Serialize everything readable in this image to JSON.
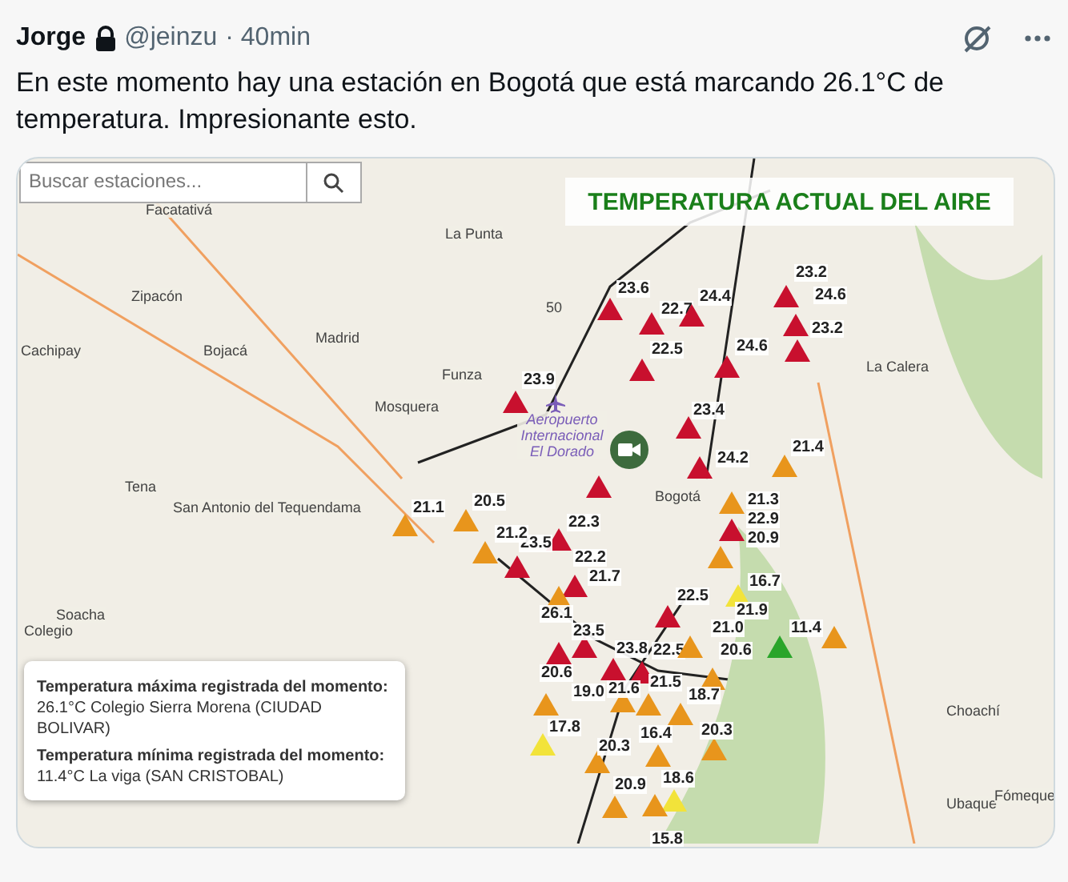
{
  "post": {
    "author": "Jorge",
    "handle": "@jeinzu",
    "time": "· 40min",
    "protected": true,
    "text": "En este momento hay una estación en Bogotá que está marcando 26.1°C de temperatura. Impresionante esto."
  },
  "map": {
    "search": {
      "placeholder": "Buscar estaciones..."
    },
    "title": "TEMPERATURA ACTUAL DEL AIRE",
    "places": [
      "Facatativá",
      "La Punta",
      "Madrid",
      "Zipacón",
      "Bojacá",
      "Cachipay",
      "Funza",
      "Mosquera",
      "Tena",
      "San Antonio del Tequendama",
      "Soacha",
      "Bogotá",
      "La Calera",
      "Choachí",
      "Ubaque",
      "Fómeque",
      "Colegio",
      "Aeropuerto Internacional El Dorado",
      "50"
    ],
    "stations": [
      {
        "reading": "23.6",
        "color": "#c8102e"
      },
      {
        "reading": "22.7",
        "color": "#c8102e"
      },
      {
        "reading": "24.4",
        "color": "#c8102e"
      },
      {
        "reading": "22.5",
        "color": "#c8102e"
      },
      {
        "reading": "24.6",
        "color": "#c8102e"
      },
      {
        "reading": "23.2",
        "color": "#c8102e"
      },
      {
        "reading": "24.6",
        "color": "#c8102e"
      },
      {
        "reading": "23.2",
        "color": "#c8102e"
      },
      {
        "reading": "23.9",
        "color": "#c8102e"
      },
      {
        "reading": "23.4",
        "color": "#c8102e"
      },
      {
        "reading": "24.2",
        "color": "#c8102e"
      },
      {
        "reading": "22.3",
        "color": "#c8102e"
      },
      {
        "reading": "23.5",
        "color": "#c8102e"
      },
      {
        "reading": "22.2",
        "color": "#c8102e"
      },
      {
        "reading": "21.7",
        "color": "#c8102e"
      },
      {
        "reading": "22.5",
        "color": "#c8102e"
      },
      {
        "reading": "23.5",
        "color": "#c8102e"
      },
      {
        "reading": "23.8",
        "color": "#c8102e"
      },
      {
        "reading": "22.5",
        "color": "#c8102e"
      },
      {
        "reading": "20.6",
        "color": "#c8102e"
      },
      {
        "reading": "21.1",
        "color": "#e8951c"
      },
      {
        "reading": "20.5",
        "color": "#e8951c"
      },
      {
        "reading": "21.2",
        "color": "#e8951c"
      },
      {
        "reading": "26.1",
        "color": "#e8951c"
      },
      {
        "reading": "21.3",
        "color": "#e8951c"
      },
      {
        "reading": "22.9",
        "color": "#e8951c"
      },
      {
        "reading": "20.9",
        "color": "#c8102e"
      },
      {
        "reading": "21.4",
        "color": "#e8951c"
      },
      {
        "reading": "16.7",
        "color": "#e8951c"
      },
      {
        "reading": "21.9",
        "color": "#f2e33a"
      },
      {
        "reading": "21.0",
        "color": "#e8951c"
      },
      {
        "reading": "20.6",
        "color": "#e8951c"
      },
      {
        "reading": "11.4",
        "color": "#2aa52a"
      },
      {
        "reading": "19.0",
        "color": "#e8951c"
      },
      {
        "reading": "21.6",
        "color": "#e8951c"
      },
      {
        "reading": "21.5",
        "color": "#e8951c"
      },
      {
        "reading": "18.7",
        "color": "#e8951c"
      },
      {
        "reading": "17.8",
        "color": "#f2e33a"
      },
      {
        "reading": "16.4",
        "color": "#e8951c"
      },
      {
        "reading": "20.3",
        "color": "#e8951c"
      },
      {
        "reading": "20.3",
        "color": "#e8951c"
      },
      {
        "reading": "18.6",
        "color": "#f2e33a"
      },
      {
        "reading": "20.9",
        "color": "#e8951c"
      },
      {
        "reading": "15.8",
        "color": "#e8951c"
      }
    ],
    "info": [
      "**Temperatura máxima registrada del momento:** 26.1°C Colegio Sierra Morena (CIUDAD BOLIVAR)",
      "**Temperatura mínima registrada del momento:** 11.4°C La viga (SAN CRISTOBAL)"
    ]
  }
}
